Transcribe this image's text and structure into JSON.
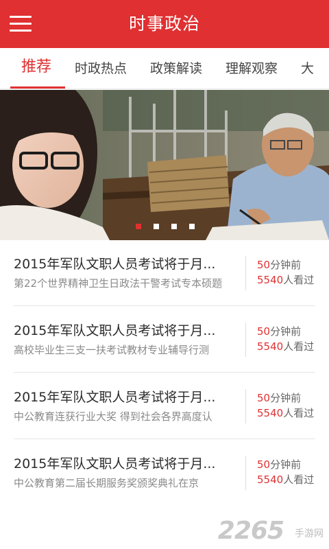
{
  "header": {
    "title": "时事政治",
    "menu_icon": "hamburger-menu-icon",
    "background_color": "#e03031"
  },
  "tabs": [
    {
      "label": "推荐",
      "active": true
    },
    {
      "label": "时政热点",
      "active": false
    },
    {
      "label": "政策解读",
      "active": false
    },
    {
      "label": "理解观察",
      "active": false
    },
    {
      "label": "大",
      "active": false
    }
  ],
  "banner": {
    "slide_count": 4,
    "active_slide": 1
  },
  "news": [
    {
      "title": "2015年军队文职人员考试将于月...",
      "subtitle": "第22个世界精神卫生日政法干警考试专本硕题",
      "time_num": "50",
      "time_unit": "分钟前",
      "views_num": "5540",
      "views_unit": "人看过"
    },
    {
      "title": "2015年军队文职人员考试将于月...",
      "subtitle": "高校毕业生三支一扶考试教材专业辅导行测",
      "time_num": "50",
      "time_unit": "分钟前",
      "views_num": "5540",
      "views_unit": "人看过"
    },
    {
      "title": "2015年军队文职人员考试将于月...",
      "subtitle": "中公教育连获行业大奖 得到社会各界高度认",
      "time_num": "50",
      "time_unit": "分钟前",
      "views_num": "5540",
      "views_unit": "人看过"
    },
    {
      "title": "2015年军队文职人员考试将于月...",
      "subtitle": "中公教育第二届长期服务奖颁奖典礼在京",
      "time_num": "50",
      "time_unit": "分钟前",
      "views_num": "5540",
      "views_unit": "人看过"
    }
  ],
  "watermark": {
    "number": "2265",
    "text": "手游网"
  },
  "colors": {
    "accent": "#e03031",
    "text_primary": "#2b2b2b",
    "text_secondary": "#8a8a8a"
  }
}
